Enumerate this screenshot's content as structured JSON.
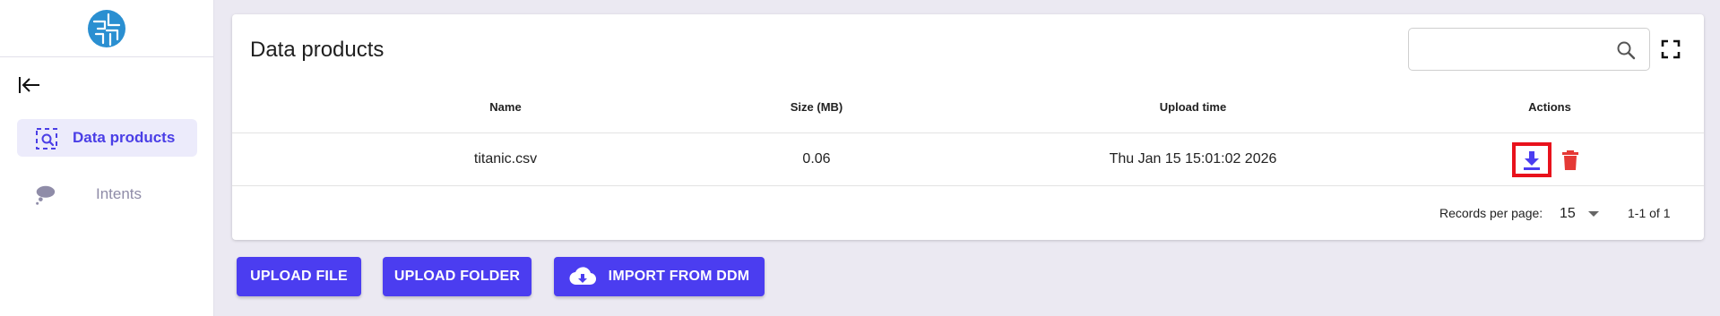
{
  "sidebar": {
    "items": [
      {
        "label": "Data products",
        "icon": "data-search-icon",
        "active": true
      },
      {
        "label": "Intents",
        "icon": "thought-cloud-icon",
        "active": false
      }
    ]
  },
  "main": {
    "title": "Data products",
    "search": {
      "value": "",
      "placeholder": ""
    },
    "table": {
      "columns": [
        "Name",
        "Size (MB)",
        "Upload time",
        "Actions"
      ],
      "rows": [
        {
          "name": "titanic.csv",
          "size": "0.06",
          "upload_time": "Thu Jan 15 15:01:02 2026"
        }
      ]
    },
    "pagination": {
      "records_per_page_label": "Records per page:",
      "records_per_page_value": "15",
      "range": "1-1 of 1"
    }
  },
  "actions": {
    "upload_file": "UPLOAD FILE",
    "upload_folder": "UPLOAD FOLDER",
    "import_ddm": "IMPORT FROM DDM"
  },
  "colors": {
    "accent": "#4b3df0",
    "delete": "#e53935",
    "highlight": "#e8121c",
    "background": "#ebe9f2"
  }
}
